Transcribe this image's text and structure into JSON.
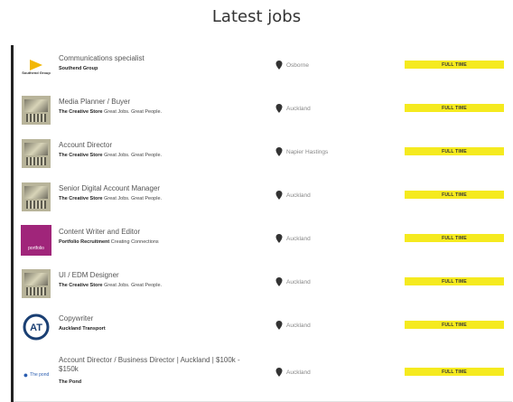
{
  "page_title": "Latest jobs",
  "jobs": [
    {
      "title": "Communications specialist",
      "company": "Southend Group",
      "tagline": "",
      "location": "Osborne",
      "type": "FULL TIME",
      "logo": "southend-logo",
      "logo_text": "Southend Group"
    },
    {
      "title": "Media Planner / Buyer",
      "company": "The Creative Store",
      "tagline": "Great Jobs. Great People.",
      "location": "Auckland",
      "type": "FULL TIME",
      "logo": "creative-store-logo"
    },
    {
      "title": "Account Director",
      "company": "The Creative Store",
      "tagline": "Great Jobs. Great People.",
      "location": "Napier Hastings",
      "type": "FULL TIME",
      "logo": "creative-store-logo"
    },
    {
      "title": "Senior Digital Account Manager",
      "company": "The Creative Store",
      "tagline": "Great Jobs. Great People.",
      "location": "Auckland",
      "type": "FULL TIME",
      "logo": "creative-store-logo"
    },
    {
      "title": "Content Writer and Editor",
      "company": "Portfolio Recruitment",
      "tagline": "Creating Connections",
      "location": "Auckland",
      "type": "FULL TIME",
      "logo": "portfolio-logo",
      "logo_text": "portfolio"
    },
    {
      "title": "UI / EDM Designer",
      "company": "The Creative Store",
      "tagline": "Great Jobs. Great People.",
      "location": "Auckland",
      "type": "FULL TIME",
      "logo": "creative-store-logo"
    },
    {
      "title": "Copywriter",
      "company": "Auckland Transport",
      "tagline": "",
      "location": "Auckland",
      "type": "FULL TIME",
      "logo": "auckland-transport-logo",
      "logo_text": "AT"
    },
    {
      "title": "Account Director / Business Director | Auckland | $100k - $150k",
      "company": "The Pond",
      "tagline": "",
      "location": "Auckland",
      "type": "FULL TIME",
      "logo": "the-pond-logo",
      "logo_text": "The pond"
    }
  ],
  "colors": {
    "badge": "#f5ea1f",
    "portfolio": "#a0257a",
    "at_blue": "#1a3f73",
    "pond_blue": "#2a5db0"
  }
}
